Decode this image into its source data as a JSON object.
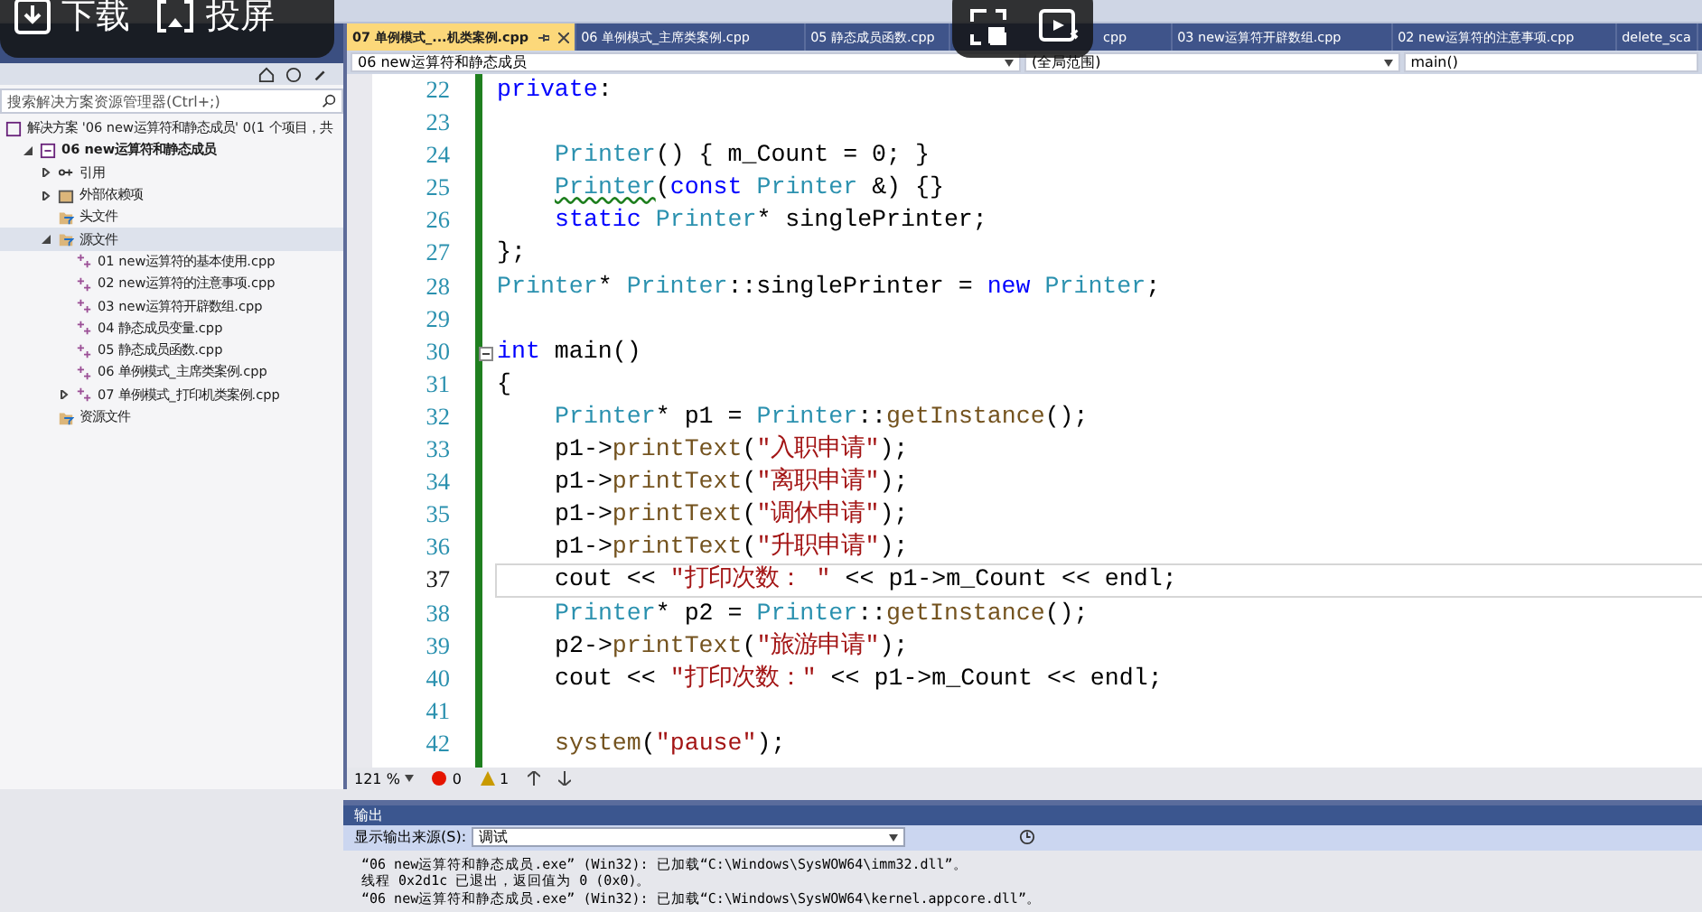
{
  "overlay": {
    "buttons": [
      {
        "label": "下载",
        "kind": "download"
      },
      {
        "label": "投屏",
        "kind": "cast"
      }
    ],
    "icons": [
      {
        "kind": "pip"
      },
      {
        "kind": "play"
      }
    ]
  },
  "solution_explorer": {
    "search": {
      "placeholder": "搜索解决方案资源管理器(Ctrl+;)"
    },
    "tree": [
      {
        "label": "解决方案 '06 new运算符和静态成员' 0(1 个项目，共",
        "kind": "solution",
        "selected": false,
        "children": [
          {
            "label": "06 new运算符和静态成员",
            "kind": "project",
            "expanded": true,
            "selected": false,
            "children": [
              {
                "label": "引用",
                "kind": "ref",
                "expanded": false,
                "selected": false
              },
              {
                "label": "外部依赖项",
                "kind": "ext",
                "expanded": false,
                "selected": false
              },
              {
                "label": "头文件",
                "kind": "filter",
                "selected": false
              },
              {
                "label": "源文件",
                "kind": "filter",
                "expanded": true,
                "selected": true,
                "children": [
                  {
                    "label": "01 new运算符的基本使用.cpp",
                    "kind": "cpp",
                    "selected": false
                  },
                  {
                    "label": "02 new运算符的注意事项.cpp",
                    "kind": "cpp",
                    "selected": false
                  },
                  {
                    "label": "03 new运算符开辟数组.cpp",
                    "kind": "cpp",
                    "selected": false
                  },
                  {
                    "label": "04 静态成员变量.cpp",
                    "kind": "cpp",
                    "selected": false
                  },
                  {
                    "label": "05 静态成员函数.cpp",
                    "kind": "cpp",
                    "selected": false
                  },
                  {
                    "label": "06 单例模式_主席类案例.cpp",
                    "kind": "cpp",
                    "selected": false
                  },
                  {
                    "label": "07 单例模式_打印机类案例.cpp",
                    "kind": "cpp",
                    "expanded": false,
                    "selected": false
                  }
                ]
              },
              {
                "label": "资源文件",
                "kind": "filter",
                "selected": false
              }
            ]
          }
        ]
      }
    ]
  },
  "tabs": [
    {
      "label": "07 单例模式_...机类案例.cpp",
      "selected": true
    },
    {
      "label": "06 单例模式_主席类案例.cpp",
      "selected": false
    },
    {
      "label": "05 静态成员函数.cpp",
      "selected": false
    },
    {
      "label": "cpp",
      "selected": false
    },
    {
      "label": "03 new运算符开辟数组.cpp",
      "selected": false
    },
    {
      "label": "02 new运算符的注意事项.cpp",
      "selected": false
    },
    {
      "label": "delete_sca",
      "selected": false
    }
  ],
  "nav": {
    "project": "06 new运算符和静态成员",
    "scope": "(全局范围)",
    "member": "main()"
  },
  "code": [
    {
      "number": "22",
      "tokens": [
        {
          "kind": "kw",
          "text": "private"
        },
        {
          "kind": "plain",
          "text": ":"
        }
      ]
    },
    {
      "number": "23"
    },
    {
      "number": "24",
      "indent": true,
      "tokens": [
        {
          "kind": "type",
          "text": "Printer"
        },
        {
          "kind": "plain",
          "text": "() { m_Count = 0; }"
        }
      ]
    },
    {
      "number": "25",
      "indent": true,
      "tokens": [
        {
          "kind": "type_warn",
          "text": "Printer"
        },
        {
          "kind": "plain",
          "text": "("
        },
        {
          "kind": "kw",
          "text": "const "
        },
        {
          "kind": "type",
          "text": "Printer"
        },
        {
          "kind": "plain",
          "text": " &) {}"
        }
      ]
    },
    {
      "number": "26",
      "indent": true,
      "tokens": [
        {
          "kind": "kw",
          "text": "static "
        },
        {
          "kind": "type",
          "text": "Printer"
        },
        {
          "kind": "plain",
          "text": "* singlePrinter;"
        }
      ]
    },
    {
      "number": "27",
      "tokens": [
        {
          "kind": "plain",
          "text": "};"
        }
      ]
    },
    {
      "number": "28",
      "tokens": [
        {
          "kind": "type",
          "text": "Printer"
        },
        {
          "kind": "plain",
          "text": "* "
        },
        {
          "kind": "type",
          "text": "Printer"
        },
        {
          "kind": "plain",
          "text": "::singlePrinter = "
        },
        {
          "kind": "kw",
          "text": "new "
        },
        {
          "kind": "type",
          "text": "Printer"
        },
        {
          "kind": "plain",
          "text": ";"
        }
      ]
    },
    {
      "number": "29"
    },
    {
      "number": "30",
      "fold": true,
      "tokens": [
        {
          "kind": "kw",
          "text": "int"
        },
        {
          "kind": "plain",
          "text": " main()"
        }
      ]
    },
    {
      "number": "31",
      "tokens": [
        {
          "kind": "plain",
          "text": "{"
        }
      ]
    },
    {
      "number": "32",
      "indent": true,
      "tokens": [
        {
          "kind": "type",
          "text": "Printer"
        },
        {
          "kind": "plain",
          "text": "* p1 = "
        },
        {
          "kind": "type",
          "text": "Printer"
        },
        {
          "kind": "plain",
          "text": "::"
        },
        {
          "kind": "fn",
          "text": "getInstance"
        },
        {
          "kind": "plain",
          "text": "();"
        }
      ]
    },
    {
      "number": "33",
      "indent": true,
      "tokens": [
        {
          "kind": "plain",
          "text": "p1->"
        },
        {
          "kind": "fn",
          "text": "printText"
        },
        {
          "kind": "plain",
          "text": "("
        },
        {
          "kind": "str",
          "text": "\"入职申请\""
        },
        {
          "kind": "plain",
          "text": ");"
        }
      ]
    },
    {
      "number": "34",
      "indent": true,
      "tokens": [
        {
          "kind": "plain",
          "text": "p1->"
        },
        {
          "kind": "fn",
          "text": "printText"
        },
        {
          "kind": "plain",
          "text": "("
        },
        {
          "kind": "str",
          "text": "\"离职申请\""
        },
        {
          "kind": "plain",
          "text": ");"
        }
      ]
    },
    {
      "number": "35",
      "indent": true,
      "tokens": [
        {
          "kind": "plain",
          "text": "p1->"
        },
        {
          "kind": "fn",
          "text": "printText"
        },
        {
          "kind": "plain",
          "text": "("
        },
        {
          "kind": "str",
          "text": "\"调休申请\""
        },
        {
          "kind": "plain",
          "text": ");"
        }
      ]
    },
    {
      "number": "36",
      "indent": true,
      "tokens": [
        {
          "kind": "plain",
          "text": "p1->"
        },
        {
          "kind": "fn",
          "text": "printText"
        },
        {
          "kind": "plain",
          "text": "("
        },
        {
          "kind": "str",
          "text": "\"升职申请\""
        },
        {
          "kind": "plain",
          "text": ");"
        }
      ]
    },
    {
      "number": "37",
      "indent": true,
      "current": true,
      "tokens": [
        {
          "kind": "plain",
          "text": "cout << "
        },
        {
          "kind": "str",
          "text": "\"打印次数： \""
        },
        {
          "kind": "plain",
          "text": " << p1->m_Count << endl;"
        }
      ]
    },
    {
      "number": "38",
      "indent": true,
      "tokens": [
        {
          "kind": "type",
          "text": "Printer"
        },
        {
          "kind": "plain",
          "text": "* p2 = "
        },
        {
          "kind": "type",
          "text": "Printer"
        },
        {
          "kind": "plain",
          "text": "::"
        },
        {
          "kind": "fn",
          "text": "getInstance"
        },
        {
          "kind": "plain",
          "text": "();"
        }
      ]
    },
    {
      "number": "39",
      "indent": true,
      "tokens": [
        {
          "kind": "plain",
          "text": "p2->"
        },
        {
          "kind": "fn",
          "text": "printText"
        },
        {
          "kind": "plain",
          "text": "("
        },
        {
          "kind": "str",
          "text": "\"旅游申请\""
        },
        {
          "kind": "plain",
          "text": ");"
        }
      ]
    },
    {
      "number": "40",
      "indent": true,
      "tokens": [
        {
          "kind": "plain",
          "text": "cout << "
        },
        {
          "kind": "str",
          "text": "\"打印次数：\""
        },
        {
          "kind": "plain",
          "text": " << p1->m_Count << endl;"
        }
      ]
    },
    {
      "number": "41"
    },
    {
      "number": "42",
      "indent": true,
      "tokens": [
        {
          "kind": "fn",
          "text": "system"
        },
        {
          "kind": "plain",
          "text": "("
        },
        {
          "kind": "str",
          "text": "\"pause\""
        },
        {
          "kind": "plain",
          "text": ");"
        }
      ]
    }
  ],
  "status": {
    "zoom": "121 %",
    "errors": "0",
    "warnings": "1"
  },
  "output": {
    "title": "输出",
    "source_label": "显示输出来源(S):",
    "source": "调试",
    "lines": [
      "“06 new运算符和静态成员.exe” (Win32): 已加载“C:\\Windows\\SysWOW64\\imm32.dll”。",
      "线程 0x2d1c 已退出，返回值为 0 (0x0)。",
      "“06 new运算符和静态成员.exe” (Win32): 已加载“C:\\Windows\\SysWOW64\\kernel.appcore.dll”。"
    ]
  }
}
